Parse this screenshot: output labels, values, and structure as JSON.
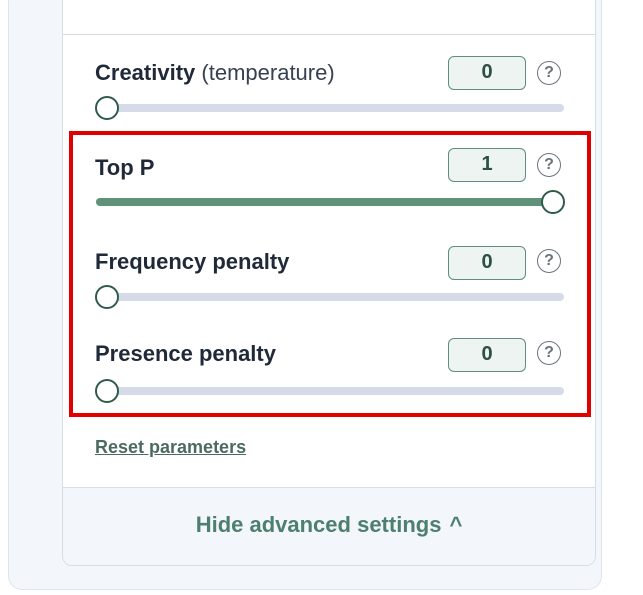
{
  "params": [
    {
      "label": "Creativity",
      "label_suffix": "(temperature)",
      "value": "0",
      "slider_fraction": 0
    },
    {
      "label": "Top P",
      "label_suffix": "",
      "value": "1",
      "slider_fraction": 1
    },
    {
      "label": "Frequency penalty",
      "label_suffix": "",
      "value": "0",
      "slider_fraction": 0
    },
    {
      "label": "Presence penalty",
      "label_suffix": "",
      "value": "0",
      "slider_fraction": 0
    }
  ],
  "help_glyph": "?",
  "reset_label": "Reset parameters",
  "hide_advanced_label": "Hide advanced settings",
  "hide_advanced_caret": "^",
  "colors": {
    "accent_green": "#5f9278",
    "highlight_red": "#e00000",
    "track": "#d5dbe8"
  }
}
